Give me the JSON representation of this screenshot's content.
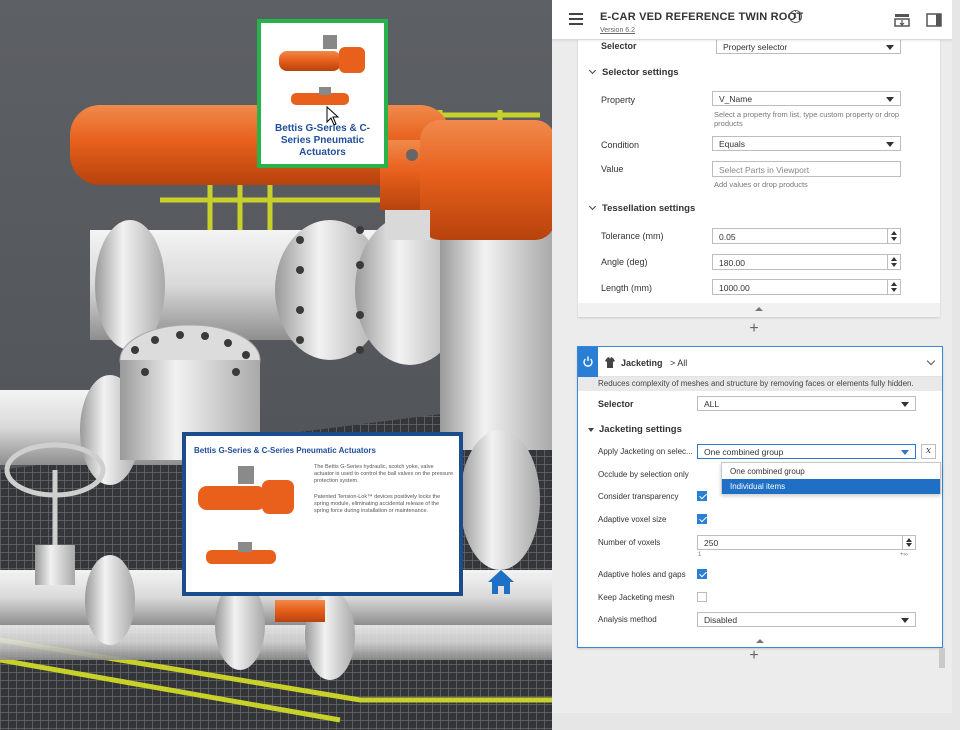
{
  "viewport": {
    "callout_small": {
      "title": "Bettis G-Series & C-Series Pneumatic Actuators"
    },
    "callout_big": {
      "title": "Bettis G-Series & C-Series Pneumatic Actuators",
      "paragraph1": "The Bettis G-Series hydraulic, scotch yoke, valve actuator is used to control the ball valves on the pressure protection system.",
      "paragraph2": "Patented Tension-Lok™ devices positively locks the spring module, eliminating accidental release of the spring force during installation or maintenance."
    }
  },
  "header": {
    "title": "E-CAR VED REFERENCE TWIN ROOT",
    "version": "Version 6.2"
  },
  "card1": {
    "selector_label": "Selector",
    "selector_value": "Property selector",
    "selector_settings_title": "Selector settings",
    "property_label": "Property",
    "property_value": "V_Name",
    "property_hint": "Select a property from list, type custom property or drop products",
    "condition_label": "Condition",
    "condition_value": "Equals",
    "value_label": "Value",
    "value_placeholder": "Select Parts in Viewport",
    "value_hint": "Add values or drop products",
    "tessellation_title": "Tessellation settings",
    "tolerance_label": "Tolerance (mm)",
    "tolerance_value": "0.05",
    "angle_label": "Angle (deg)",
    "angle_value": "180.00",
    "length_label": "Length (mm)",
    "length_value": "1000.00"
  },
  "card2": {
    "title": "Jacketing",
    "breadcrumb": "> All",
    "description": "Reduces complexity of meshes and structure by removing faces or elements fully hidden.",
    "selector_label": "Selector",
    "selector_value": "ALL",
    "settings_title": "Jacketing settings",
    "apply_label": "Apply Jacketing on selec...",
    "apply_value": "One combined group",
    "apply_options": [
      "One combined group",
      "Individual items"
    ],
    "occlude_label": "Occlude by selection only",
    "transparency_label": "Consider transparency",
    "adaptive_voxel_label": "Adaptive voxel size",
    "voxels_label": "Number of voxels",
    "voxels_value": "250",
    "voxels_min": "1",
    "voxels_max": "+∞",
    "holes_label": "Adaptive holes and gaps",
    "keep_mesh_label": "Keep Jacketing mesh",
    "analysis_label": "Analysis method",
    "analysis_value": "Disabled"
  },
  "colors": {
    "accent": "#2a7fd4",
    "callout_green": "#27b34a",
    "callout_blue": "#1b4d8c",
    "pipe_orange": "#e8601c"
  }
}
